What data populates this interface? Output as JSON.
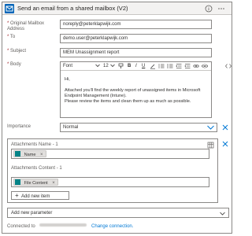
{
  "header": {
    "title": "Send an email from a shared mailbox (V2)"
  },
  "fields": {
    "original_mailbox": {
      "label": "Original Mailbox Address",
      "value": "noreply@peterklapwijk.com"
    },
    "to": {
      "label": "To",
      "value": "demo.user@peterklapwijk.com"
    },
    "subject": {
      "label": "Subject",
      "value": "MEM Unassignment report"
    },
    "body": {
      "label": "Body",
      "toolbar": {
        "font": "Font",
        "size": "12"
      },
      "lines": [
        "Hi,",
        "Attached you'll find the weekly report of unassigned items in Microsoft Endpoint Management (Intune).",
        "Please review the items and clean them up as much as possible."
      ]
    },
    "importance": {
      "label": "Importance",
      "value": "Normal"
    }
  },
  "attachments": {
    "name_label": "Attachments Name - 1",
    "name_token": "Name",
    "content_label": "Attachments Content - 1",
    "content_token": "File Content",
    "add_item_label": "Add new item"
  },
  "add_parameter": {
    "placeholder": "Add new parameter"
  },
  "footer": {
    "connected_label": "Connected to",
    "change_link": "Change connection."
  },
  "colors": {
    "accent": "#0078d4",
    "required": "#a4262c",
    "token_icon": "#038387",
    "outlook_blue": "#0364b8"
  }
}
